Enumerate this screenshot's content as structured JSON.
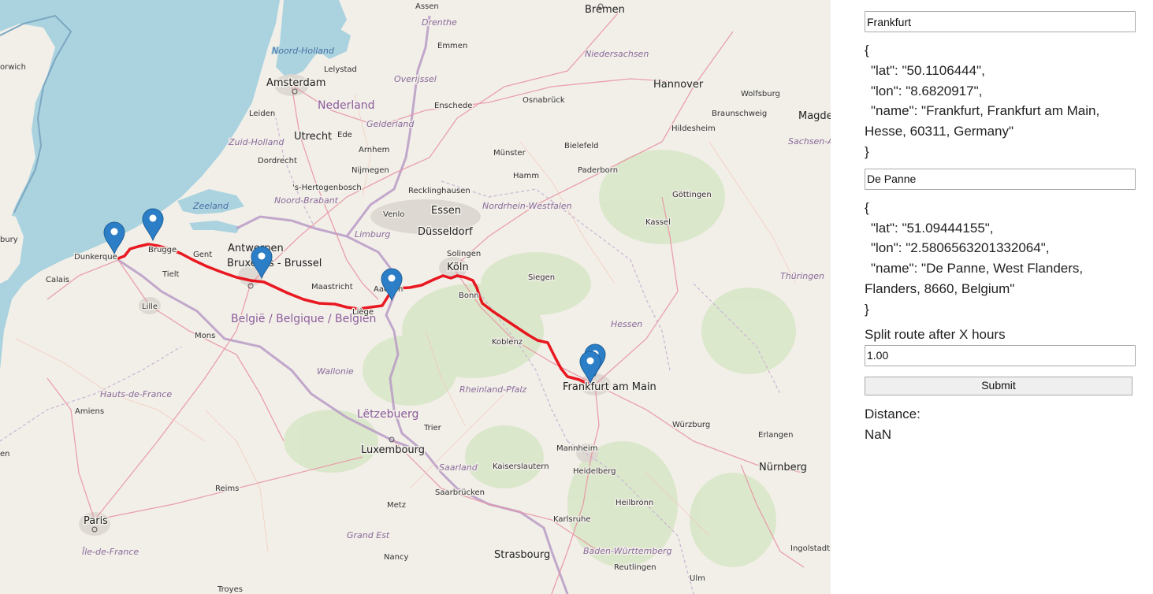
{
  "map": {
    "labels": {
      "water": [
        "Zeeland",
        "Noord-Holland"
      ],
      "regions": [
        "Drenthe",
        "Overijssel",
        "Gelderland",
        "Zuid-Holland",
        "Noord-Brabant",
        "Limburg",
        "Nordrhein-Westfalen",
        "Niedersachsen",
        "Hessen",
        "Thüringen",
        "Sachsen-A",
        "Wallonie",
        "Hauts-de-France",
        "Rheinland-Pfalz",
        "Saarland",
        "Grand Est",
        "Baden-Württemberg",
        "Île-de-France"
      ],
      "countries": [
        "Nederland",
        "België / Belgique / Belgien",
        "Lëtzebuerg"
      ],
      "big_cities": [
        "Amsterdam",
        "Bremen",
        "Hannover",
        "Utrecht",
        "Essen",
        "Düsseldorf",
        "Köln",
        "Antwerpen",
        "Bruxelles - Brussel",
        "Frankfurt am Main",
        "Luxembourg",
        "Paris",
        "Strasbourg",
        "Nürnberg",
        "Magde"
      ],
      "towns": [
        "Assen",
        "Emmen",
        "Lelystad",
        "Leiden",
        "Enschede",
        "Osnabrück",
        "Wolfsburg",
        "Braunschweig",
        "Hildesheim",
        "Bielefeld",
        "Münster",
        "Paderborn",
        "Hamm",
        "Göttingen",
        "Kassel",
        "Dordrecht",
        "Arnhem",
        "Ede",
        "Nijmegen",
        "'s-Hertogenbosch",
        "Recklinghausen",
        "Venlo",
        "Dunkerque",
        "Brugge",
        "Gent",
        "Tielt",
        "Calais",
        "Lille",
        "Mons",
        "Maastricht",
        "Liège",
        "Aachen",
        "Solingen",
        "Bonn",
        "Siegen",
        "Koblenz",
        "Würzburg",
        "Erlangen",
        "Trier",
        "Mannheim",
        "Heidelberg",
        "Kaiserslautern",
        "Saarbrücken",
        "Heilbronn",
        "Metz",
        "Karlsruhe",
        "Nancy",
        "Reims",
        "Amiens",
        "Reutlingen",
        "Ingolstadt",
        "Ulm",
        "Troyes",
        "orwich",
        "bury",
        "en"
      ]
    },
    "markers": [
      "Dunkerque marker",
      "Brugge marker",
      "Brussel marker",
      "Aachen marker",
      "Frankfurt marker 1",
      "Frankfurt marker 2"
    ],
    "route_color": "#e8000b",
    "marker_color": "#2c7fc6"
  },
  "panel": {
    "origin": {
      "value": "Frankfurt",
      "json_open": "{",
      "lat_line": "\"lat\": \"50.1106444\",",
      "lon_line": "\"lon\": \"8.6820917\",",
      "name_line": "\"name\": \"Frankfurt, Frankfurt am Main, Hesse, 60311, Germany\"",
      "json_close": "}"
    },
    "destination": {
      "value": "De Panne",
      "json_open": "{",
      "lat_line": "\"lat\": \"51.09444155\",",
      "lon_line": "\"lon\": \"2.5806563201332064\",",
      "name_line": "\"name\": \"De Panne, West Flanders, Flanders, 8660, Belgium\"",
      "json_close": "}"
    },
    "split_label": "Split route after X hours",
    "split_value": "1.00",
    "submit_label": "Submit",
    "distance_label": "Distance:",
    "distance_value": "NaN"
  }
}
